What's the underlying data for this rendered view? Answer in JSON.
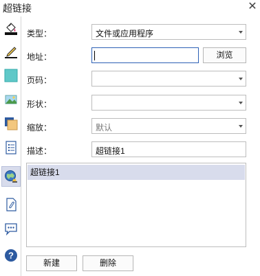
{
  "window": {
    "title": "超链接",
    "close_glyph": "✕"
  },
  "sidebar": {
    "items": [
      {
        "name": "fill-icon"
      },
      {
        "name": "pen-line-icon"
      },
      {
        "name": "color-square-icon"
      },
      {
        "name": "image-icon"
      },
      {
        "name": "shadow-square-icon"
      },
      {
        "name": "list-document-icon"
      },
      {
        "name": "hyperlink-globe-icon",
        "active": true
      },
      {
        "name": "attachment-icon"
      },
      {
        "name": "comment-icon"
      },
      {
        "name": "help-icon"
      }
    ]
  },
  "form": {
    "type_label": "类型：",
    "type_value": "文件或应用程序",
    "address_label": "地址：",
    "address_value": "",
    "browse_label": "浏览",
    "page_label": "页码：",
    "page_value": "",
    "shape_label": "形状：",
    "shape_value": "",
    "zoom_label": "缩放：",
    "zoom_value": "默认",
    "desc_label": "描述：",
    "desc_value": "超链接1"
  },
  "list": {
    "items": [
      "超链接1"
    ]
  },
  "actions": {
    "new_label": "新建",
    "delete_label": "删除"
  }
}
